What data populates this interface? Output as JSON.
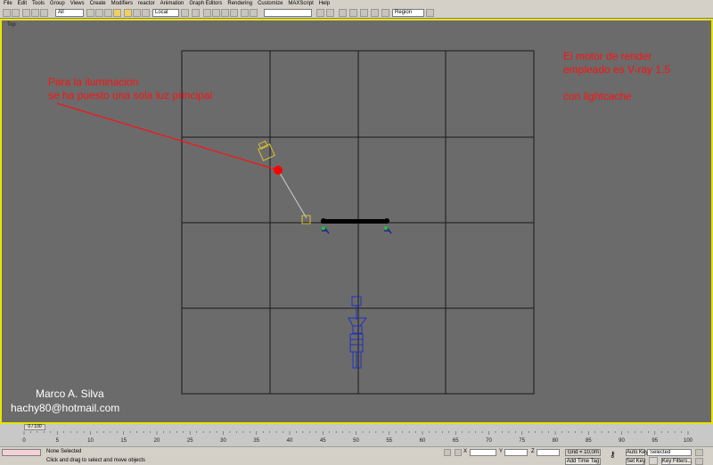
{
  "menubar": {
    "items": [
      "File",
      "Edit",
      "Tools",
      "Group",
      "Views",
      "Create",
      "Modifiers",
      "reactor",
      "Animation",
      "Graph Editors",
      "Rendering",
      "Customize",
      "MAXScript",
      "Help"
    ]
  },
  "toolbar": {
    "selection_filter": "All",
    "reference_coord": "Local",
    "named_selection": "",
    "region_select": "Region"
  },
  "viewport": {
    "label": "Top",
    "note_left": [
      "Para la iluminacion",
      "se ha puesto una sola luz principal"
    ],
    "note_right": [
      "El motor de render",
      "empleado es V-ray 1.5",
      "",
      "con lightcache"
    ],
    "credit": [
      "Marco A. Silva",
      "hachy80@hotmail.com"
    ],
    "note_color": "#ff1010",
    "border_color": "#e8e400"
  },
  "timeline": {
    "slider_label": "0 / 100",
    "ticks": [
      "0",
      "5",
      "10",
      "15",
      "20",
      "25",
      "30",
      "35",
      "40",
      "45",
      "50",
      "55",
      "60",
      "65",
      "70",
      "75",
      "80",
      "85",
      "90",
      "95",
      "100"
    ]
  },
  "statusbar": {
    "selection_status": "None Selected",
    "prompt": "Click and drag to select and move objects",
    "x_label": "X",
    "y_label": "Y",
    "z_label": "Z",
    "grid": "Grid = 10,0m",
    "add_time_tag": "Add Time Tag",
    "auto_key": "Auto Key",
    "auto_key_value": "Selected",
    "set_key": "Set Key",
    "key_filters": "Key Filters..."
  }
}
